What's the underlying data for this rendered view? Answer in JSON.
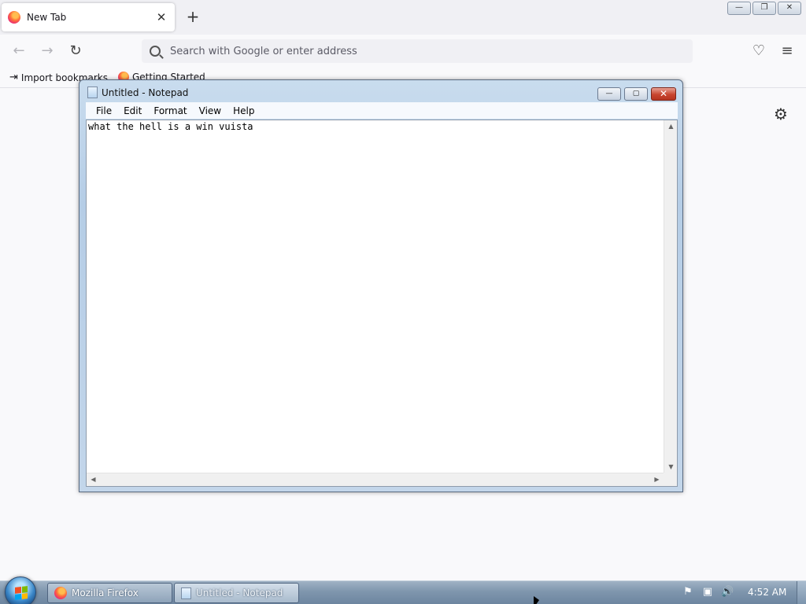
{
  "firefox": {
    "tab_title": "New Tab",
    "tab_close": "✕",
    "new_tab": "+",
    "window_controls": {
      "minimize": "—",
      "restore": "❐",
      "close": "✕"
    },
    "nav": {
      "back": "←",
      "forward": "→",
      "reload": "↻"
    },
    "urlbar_placeholder": "Search with Google or enter address",
    "pocket": "♡",
    "menu": "≡",
    "bookmarks": [
      {
        "label": "Import bookmarks...",
        "icon": "import-icon"
      },
      {
        "label": "Getting Started",
        "icon": "firefox-icon"
      }
    ],
    "settings_glyph": "⚙"
  },
  "notepad": {
    "title": "Untitled - Notepad",
    "controls": {
      "minimize": "—",
      "maximize": "▢",
      "close": "✕"
    },
    "menu": [
      "File",
      "Edit",
      "Format",
      "View",
      "Help"
    ],
    "content": "what the hell is a win vuista"
  },
  "taskbar": {
    "buttons": [
      {
        "label": "Mozilla Firefox",
        "active": false
      },
      {
        "label": "Untitled - Notepad",
        "active": true
      }
    ],
    "tray": {
      "flag": "⚑",
      "network": "▣",
      "volume": "🔊"
    },
    "clock": "4:52 AM"
  }
}
